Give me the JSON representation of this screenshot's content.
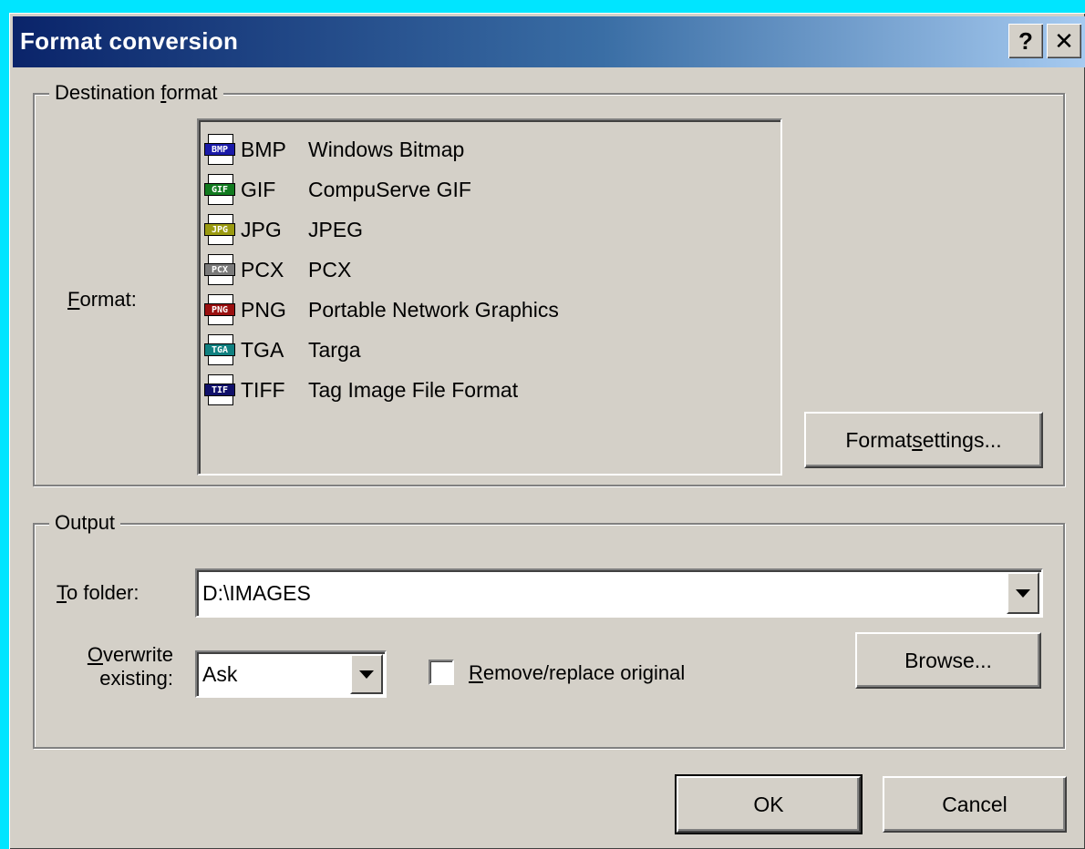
{
  "window": {
    "title": "Format conversion",
    "help_button": "?",
    "close_button": "✕"
  },
  "destination": {
    "legend_pre": "Destination ",
    "legend_ul": "f",
    "legend_post": "ormat",
    "format_label_ul": "F",
    "format_label_post": "ormat:",
    "formats": [
      {
        "ext": "BMP",
        "desc": "Windows Bitmap",
        "tag": "BMP",
        "color": "#1a1aa8"
      },
      {
        "ext": "GIF",
        "desc": "CompuServe GIF",
        "tag": "GIF",
        "color": "#117a1f"
      },
      {
        "ext": "JPG",
        "desc": "JPEG",
        "tag": "JPG",
        "color": "#9a9a10"
      },
      {
        "ext": "PCX",
        "desc": "PCX",
        "tag": "PCX",
        "color": "#7a7a7a"
      },
      {
        "ext": "PNG",
        "desc": "Portable Network Graphics",
        "tag": "PNG",
        "color": "#9a1010"
      },
      {
        "ext": "TGA",
        "desc": "Targa",
        "tag": "TGA",
        "color": "#108080"
      },
      {
        "ext": "TIFF",
        "desc": "Tag Image File Format",
        "tag": "TIF",
        "color": "#10106a"
      }
    ],
    "settings_button_pre": "Format ",
    "settings_button_ul": "s",
    "settings_button_post": "ettings..."
  },
  "output": {
    "legend": "Output",
    "folder_label_ul": "T",
    "folder_label_post": "o folder:",
    "folder_value": "D:\\IMAGES",
    "overwrite_label_ul": "O",
    "overwrite_label_line1_post": "verwrite",
    "overwrite_label_line2": "existing:",
    "overwrite_value": "Ask",
    "remove_label_ul": "R",
    "remove_label_post": "emove/replace original",
    "remove_checked": false,
    "browse_button": "Browse..."
  },
  "footer": {
    "ok_button": "OK",
    "cancel_button": "Cancel"
  }
}
